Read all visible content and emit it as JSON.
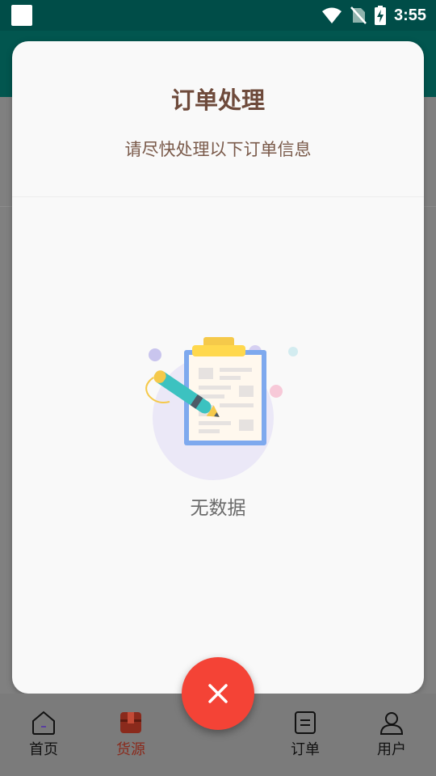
{
  "status_bar": {
    "time": "3:55"
  },
  "modal": {
    "title": "订单处理",
    "subtitle": "请尽快处理以下订单信息",
    "empty_text": "无数据"
  },
  "bottom_nav": {
    "items": [
      {
        "label": "首页",
        "icon": "home-icon",
        "active": false
      },
      {
        "label": "货源",
        "icon": "box-icon",
        "active": true
      },
      {
        "label": "订单",
        "icon": "order-icon",
        "active": false
      },
      {
        "label": "用户",
        "icon": "user-icon",
        "active": false
      }
    ]
  },
  "fab": {
    "icon": "close-icon"
  },
  "colors": {
    "status_bar": "#004d48",
    "title_brown": "#6e4a3b",
    "fab_red": "#f44336",
    "nav_active": "#8a2a1c"
  }
}
